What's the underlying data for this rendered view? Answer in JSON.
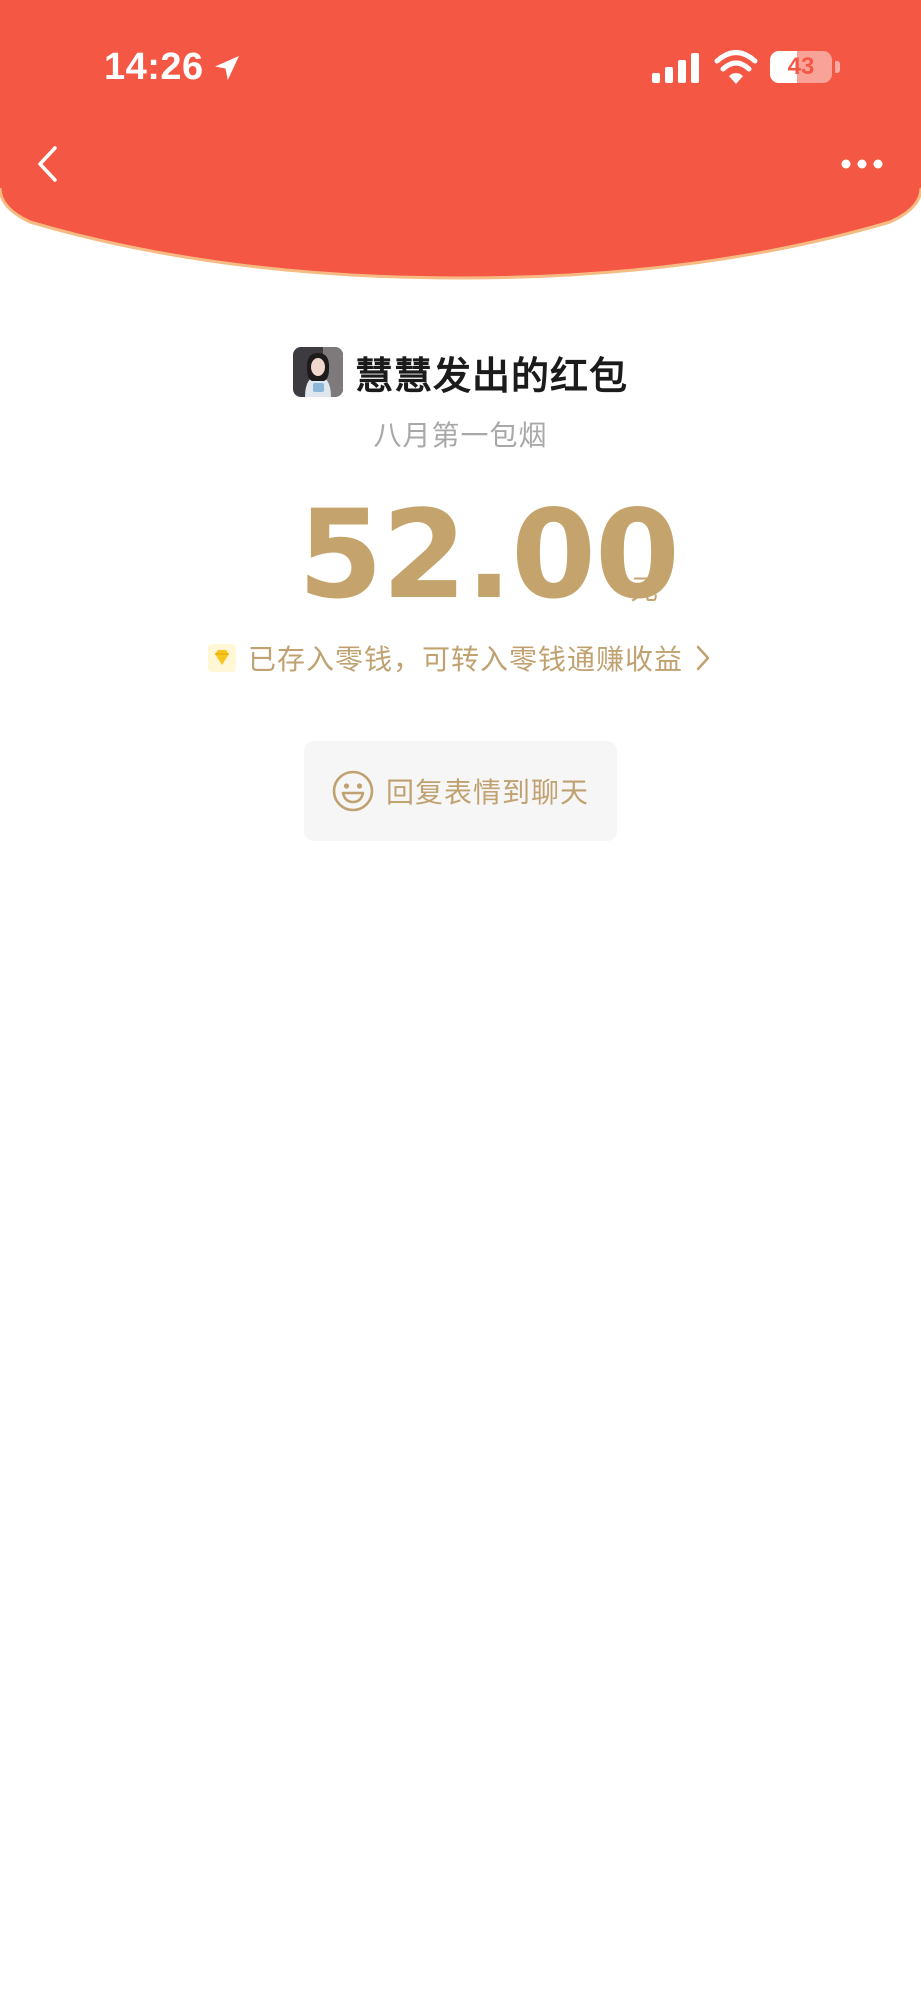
{
  "status_bar": {
    "time": "14:26",
    "battery_level": "43",
    "battery_fraction": 0.43,
    "icons": [
      "location-arrow-icon",
      "signal-icon",
      "wifi-icon",
      "battery-icon"
    ]
  },
  "nav": {
    "back_icon": "chevron-left-icon",
    "more_icon": "more-dots-icon"
  },
  "red_packet": {
    "title": "慧慧发出的红包",
    "greeting": "八月第一包烟",
    "amount": "52.00",
    "unit": "元",
    "deposit_note": "已存入零钱，可转入零钱通赚收益",
    "reply_button": "回复表情到聊天"
  },
  "colors": {
    "header_red": "#f45744",
    "gold": "#c4a46c",
    "gold_text": "#c0a271",
    "gray_text": "#a8a8a8",
    "title_text": "#1b1b1b",
    "button_bg": "#f6f6f6"
  }
}
